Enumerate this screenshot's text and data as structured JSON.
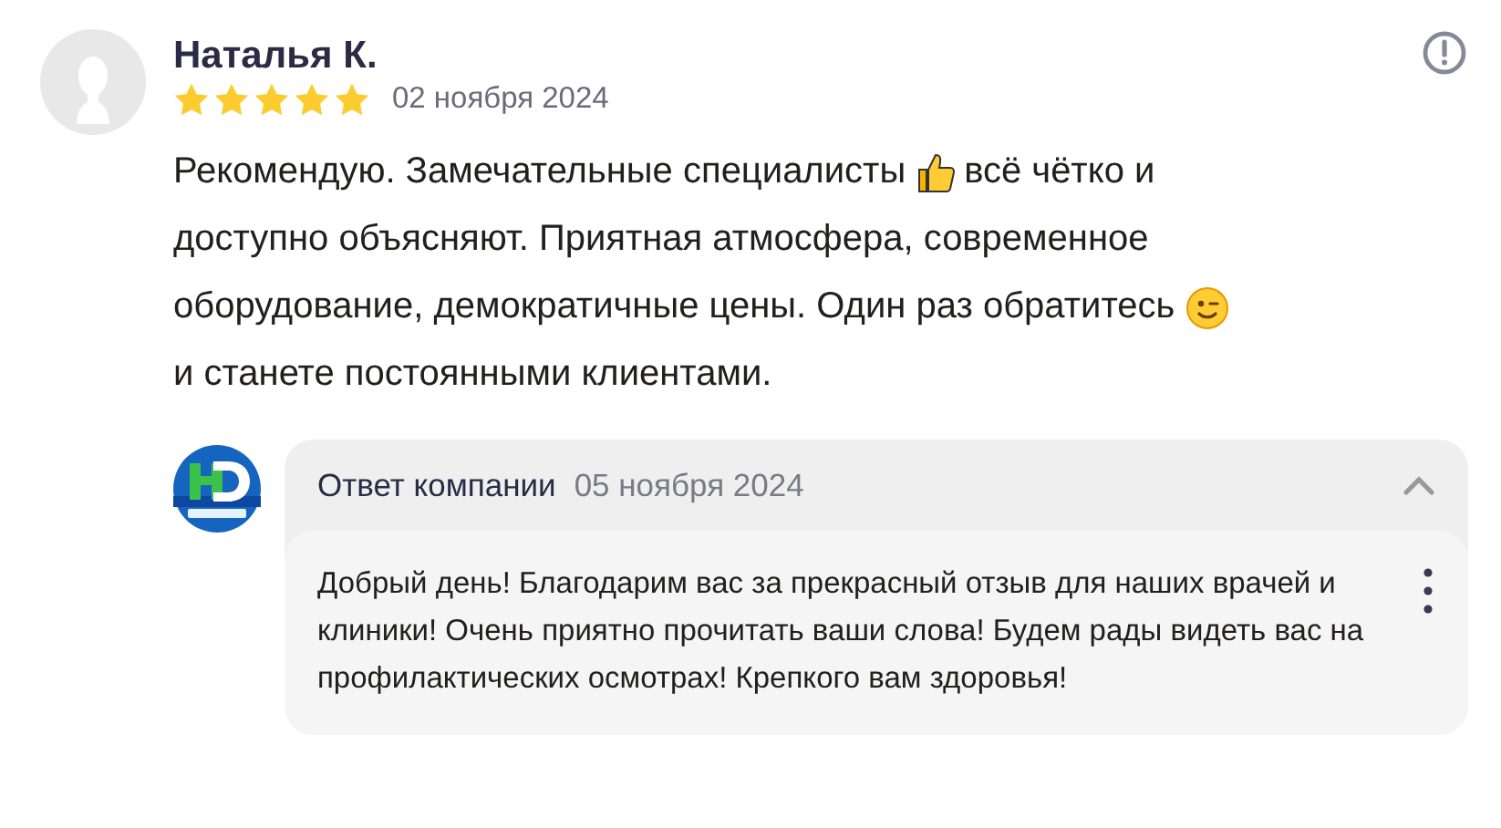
{
  "review": {
    "author": "Наталья К.",
    "stars": 5,
    "date": "02 ноября 2024",
    "lines": [
      [
        {
          "kind": "text",
          "text": "Рекомендую. Замечательные специалисты"
        },
        {
          "kind": "thumbsup"
        },
        {
          "kind": "text",
          "text": "всё чётко и"
        }
      ],
      [
        {
          "kind": "text",
          "text": "доступно объясняют. Приятная атмосфера, современное"
        }
      ],
      [
        {
          "kind": "text",
          "text": "оборудование, демократичные цены. Один раз обратитесь"
        },
        {
          "kind": "wink"
        }
      ],
      [
        {
          "kind": "text",
          "text": "и станете постоянными клиентами."
        }
      ]
    ]
  },
  "reply": {
    "title": "Ответ компании",
    "date": "05 ноября 2024",
    "expanded": true,
    "text": "Добрый день! Благодарим вас за прекрасный отзыв для наших врачей и клиники! Очень приятно прочитать ваши слова! Будем рады видеть вас на профилактических осмотрах! Крепкого вам здоровья!"
  }
}
